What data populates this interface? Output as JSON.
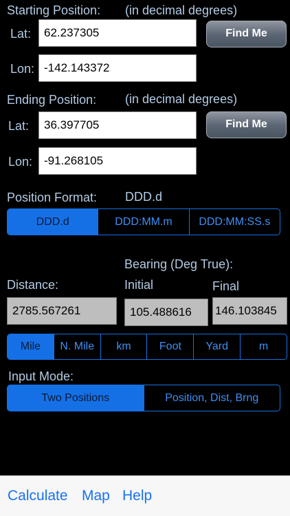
{
  "start": {
    "heading": "Starting Position:",
    "note": "(in decimal degrees)",
    "lat_label": "Lat:",
    "lat_value": "62.237305",
    "lon_label": "Lon:",
    "lon_value": "-142.143372",
    "find_me_label": "Find Me"
  },
  "end": {
    "heading": "Ending Position:",
    "note": "(in decimal degrees)",
    "lat_label": "Lat:",
    "lat_value": "36.397705",
    "lon_label": "Lon:",
    "lon_value": "-91.268105",
    "find_me_label": "Find Me"
  },
  "position_format": {
    "label": "Position Format:",
    "current": "DDD.d",
    "options": [
      "DDD.d",
      "DDD:MM.m",
      "DDD:MM:SS.s"
    ],
    "selected_index": 0
  },
  "results": {
    "bearing_heading": "Bearing (Deg True):",
    "distance_label": "Distance:",
    "distance_value": "2785.567261",
    "initial_label": "Initial",
    "initial_value": "105.488616",
    "final_label": "Final",
    "final_value": "146.103845"
  },
  "units": {
    "options": [
      "Mile",
      "N. Mile",
      "km",
      "Foot",
      "Yard",
      "m"
    ],
    "selected_index": 0
  },
  "input_mode": {
    "label": "Input Mode:",
    "options": [
      "Two Positions",
      "Position, Dist, Brng"
    ],
    "selected_index": 0
  },
  "toolbar": {
    "calculate_label": "Calculate",
    "map_label": "Map",
    "help_label": "Help"
  },
  "colors": {
    "background": "#000000",
    "label_text": "#b3cbe4",
    "accent": "#1570e6",
    "toolbar_link": "#1672f0"
  }
}
